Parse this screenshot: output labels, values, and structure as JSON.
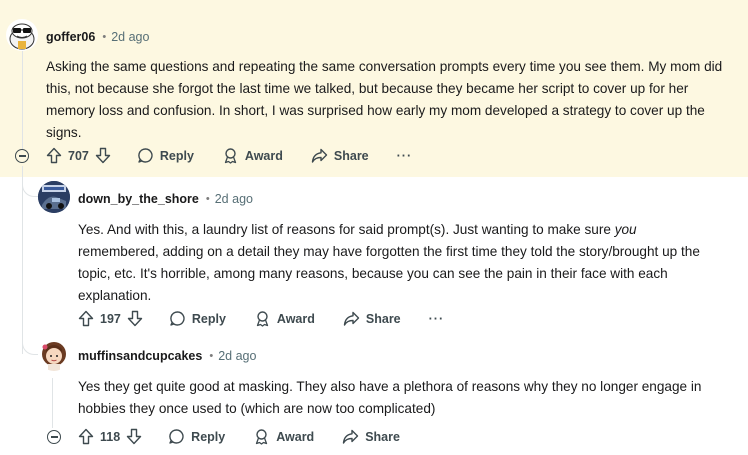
{
  "comments": [
    {
      "username": "goffer06",
      "separator": "•",
      "time": "2d ago",
      "body": "Asking the same questions and repeating the same conversation prompts every time you see them. My mom did this, not because she forgot the last time we talked, but because they became her script to cover up for her memory loss and confusion. In short, I was surprised how early my mom developed a strategy to cover up the signs.",
      "votes": "707",
      "reply_label": "Reply",
      "award_label": "Award",
      "share_label": "Share",
      "more_label": "···"
    },
    {
      "username": "down_by_the_shore",
      "separator": "•",
      "time": "2d ago",
      "body_before": "Yes. And with this, a laundry list of reasons for said prompt(s). Just wanting to make sure ",
      "body_emphasis": "you",
      "body_after": " remembered, adding on a detail they may have forgotten the first time they told the story/brought up the topic, etc. It's horrible, among many reasons, because you can see the pain in their face with each explanation.",
      "votes": "197",
      "reply_label": "Reply",
      "award_label": "Award",
      "share_label": "Share",
      "more_label": "···"
    },
    {
      "username": "muffinsandcupcakes",
      "separator": "•",
      "time": "2d ago",
      "body": "Yes they get quite good at masking. They also have a plethora of reasons why they no longer engage in hobbies they once used to (which are now too complicated)",
      "votes": "118",
      "reply_label": "Reply",
      "award_label": "Award",
      "share_label": "Share",
      "more_label": "···"
    }
  ],
  "colors": {
    "highlight": "#fdf8e1",
    "text": "#1a1a1b",
    "meta": "#576f76",
    "action": "#3e4a4f",
    "thread": "#e0e4e6"
  }
}
